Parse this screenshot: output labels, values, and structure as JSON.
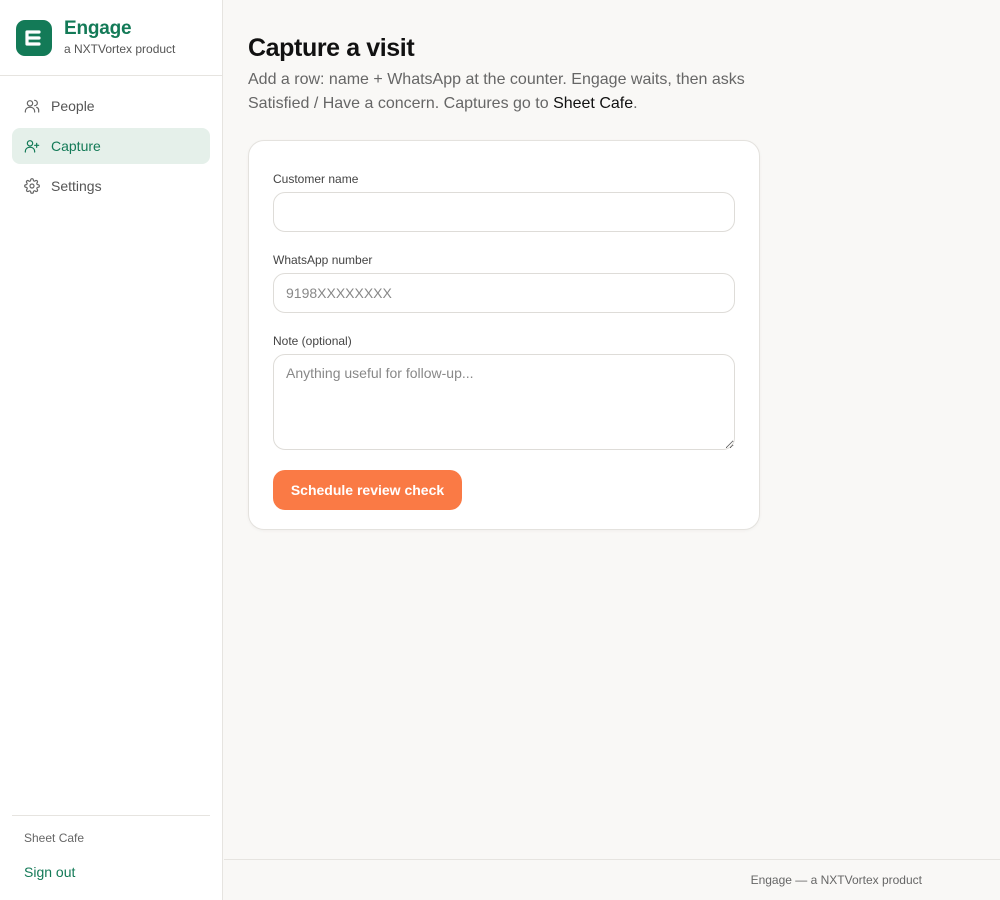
{
  "brand": {
    "name": "Engage",
    "tagline": "a NXTVortex product",
    "logo_letter": "E",
    "accent": "#137a57"
  },
  "sidebar": {
    "items": [
      {
        "label": "People",
        "icon": "users-icon",
        "active": false
      },
      {
        "label": "Capture",
        "icon": "user-plus-icon",
        "active": true
      },
      {
        "label": "Settings",
        "icon": "gear-icon",
        "active": false
      }
    ],
    "shop_name": "Sheet Cafe",
    "signout_label": "Sign out"
  },
  "page": {
    "title": "Capture a visit",
    "description_pre": "Add a row: name + WhatsApp at the counter. Engage waits, then asks Satisfied / Have a concern. Captures go to ",
    "description_link": "Sheet Cafe",
    "description_post": "."
  },
  "form": {
    "name_label": "Customer name",
    "name_value": "",
    "name_placeholder": "",
    "whatsapp_label": "WhatsApp number",
    "whatsapp_value": "",
    "whatsapp_placeholder": "9198XXXXXXXX",
    "note_label": "Note (optional)",
    "note_value": "",
    "note_placeholder": "Anything useful for follow-up...",
    "submit_label": "Schedule review check",
    "submit_color": "#fa7a45"
  },
  "footer": {
    "text": "Engage — a NXTVortex product"
  }
}
